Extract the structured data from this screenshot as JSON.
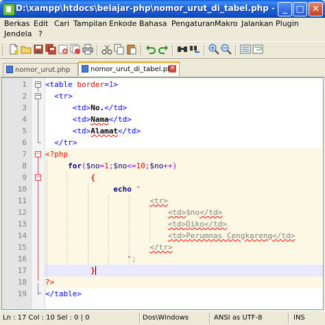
{
  "window": {
    "title": "D:\\xampp\\htdocs\\belajar-php\\nomor_urut_di_tabel.php - Not...",
    "btn_min": "_",
    "btn_max": "□",
    "btn_close": "✕"
  },
  "menu": {
    "items": [
      "Berkas",
      "Edit",
      "Cari",
      "Tampilan",
      "Enkode",
      "Bahasa",
      "Pengaturan",
      "Makro",
      "Jalankan",
      "Plugin",
      "Jendela",
      "?"
    ]
  },
  "toolbar": {
    "icons": [
      "new-file-icon",
      "open-folder-icon",
      "save-icon",
      "save-all-icon",
      "close-icon",
      "close-all-icon",
      "print-icon",
      "cut-icon",
      "copy-icon",
      "paste-icon",
      "undo-icon",
      "redo-icon",
      "find-icon",
      "replace-icon",
      "zoom-in-icon",
      "zoom-out-icon",
      "sync-icon",
      "wrap-icon"
    ]
  },
  "tabs": [
    {
      "label": "nomor_urut.php",
      "active": false
    },
    {
      "label": "nomor_urut_di_tabel.php",
      "active": true
    }
  ],
  "editor": {
    "line_numbers": [
      "1",
      "2",
      "3",
      "4",
      "5",
      "6",
      "7",
      "8",
      "9",
      "10",
      "11",
      "12",
      "13",
      "14",
      "15",
      "16",
      "17",
      "18",
      "19"
    ],
    "lines": {
      "l1": [
        "<table ",
        "border",
        "=",
        "1",
        ">"
      ],
      "l2": [
        "<tr>"
      ],
      "l3": [
        "<td>",
        "No.",
        "</td>"
      ],
      "l4": [
        "<td>",
        "Nama",
        "</td>"
      ],
      "l5": [
        "<td>",
        "Alamat",
        "</td>"
      ],
      "l6": [
        "</tr>"
      ],
      "l7": [
        "<?php"
      ],
      "l8": [
        "for",
        "(",
        "$no",
        "=",
        "1",
        ";",
        "$no",
        "<=",
        "10",
        ";",
        "$no",
        "++",
        ")"
      ],
      "l9": [
        "{"
      ],
      "l10": [
        "echo",
        " \""
      ],
      "l11": [
        "<tr>"
      ],
      "l12": [
        "<td>",
        "$no",
        "</td>"
      ],
      "l13": [
        "<td>",
        "Diko",
        "</td>"
      ],
      "l14": [
        "<td>",
        "Perumnas Cengkareng",
        "</td>"
      ],
      "l15": [
        "</tr>"
      ],
      "l16": [
        "\";"
      ],
      "l17": [
        "}"
      ],
      "l18": [
        "?>"
      ],
      "l19": [
        "</table>"
      ]
    }
  },
  "status": {
    "position": "Ln : 17   Col : 10   Sel : 0 | 0",
    "eol": "Dos\\Windows",
    "encoding": "ANSI as UTF-8",
    "mode": "INS"
  }
}
